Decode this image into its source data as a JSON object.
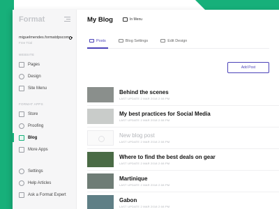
{
  "sidebar": {
    "brand": "Format",
    "account_name": "miguelmendes.formatdpscom",
    "plan": "Free Trial",
    "website_label": "WEBSITE",
    "website_items": [
      {
        "label": "Pages",
        "icon": "pages-icon"
      },
      {
        "label": "Design",
        "icon": "design-icon"
      },
      {
        "label": "Site Menu",
        "icon": "site-menu-icon"
      }
    ],
    "format_apps_label": "FORMAT APPS",
    "app_items": [
      {
        "label": "Store",
        "icon": "store-icon"
      },
      {
        "label": "Proofing",
        "icon": "proofing-icon"
      },
      {
        "label": "Blog",
        "icon": "blog-icon",
        "active": true
      },
      {
        "label": "More Apps",
        "icon": "grid-icon"
      }
    ],
    "bottom_items": [
      {
        "label": "Settings",
        "icon": "gear-icon"
      },
      {
        "label": "Help Articles",
        "icon": "help-icon"
      },
      {
        "label": "Ask a Format Expert",
        "icon": "chat-icon"
      }
    ]
  },
  "main": {
    "title": "My Blog",
    "menu_toggle": "In Menu",
    "tabs": [
      {
        "label": "Posts",
        "active": true
      },
      {
        "label": "Blog Settings"
      },
      {
        "label": "Edit Design"
      }
    ],
    "add_post": "Add Post",
    "posts": [
      {
        "title": "Behind the scenes",
        "meta": "LAST UPDATE 2 MAR 2018 2:08 PM",
        "draft": false,
        "thumb_color": "#8a8f8c"
      },
      {
        "title": "My best practices for Social Media",
        "meta": "LAST UPDATE 2 MAR 2018 2:08 PM",
        "draft": false,
        "thumb_color": "#c9ccca"
      },
      {
        "title": "New blog post",
        "meta": "LAST UPDATE 2 MAR 2018 2:08 PM",
        "draft": true,
        "thumb_color": ""
      },
      {
        "title": "Where to find the best deals on gear",
        "meta": "LAST UPDATE 2 MAR 2018 2:08 PM",
        "draft": false,
        "thumb_color": "#4a6b45"
      },
      {
        "title": "Martinique",
        "meta": "LAST UPDATE 2 MAR 2018 2:08 PM",
        "draft": false,
        "thumb_color": "#6f7d76"
      },
      {
        "title": "Gabon",
        "meta": "LAST UPDATE 2 MAR 2018 2:08 PM",
        "draft": false,
        "thumb_color": "#5f7f86"
      }
    ]
  },
  "colors": {
    "brand_green": "#17b07a",
    "accent_purple": "#4a41b8"
  }
}
